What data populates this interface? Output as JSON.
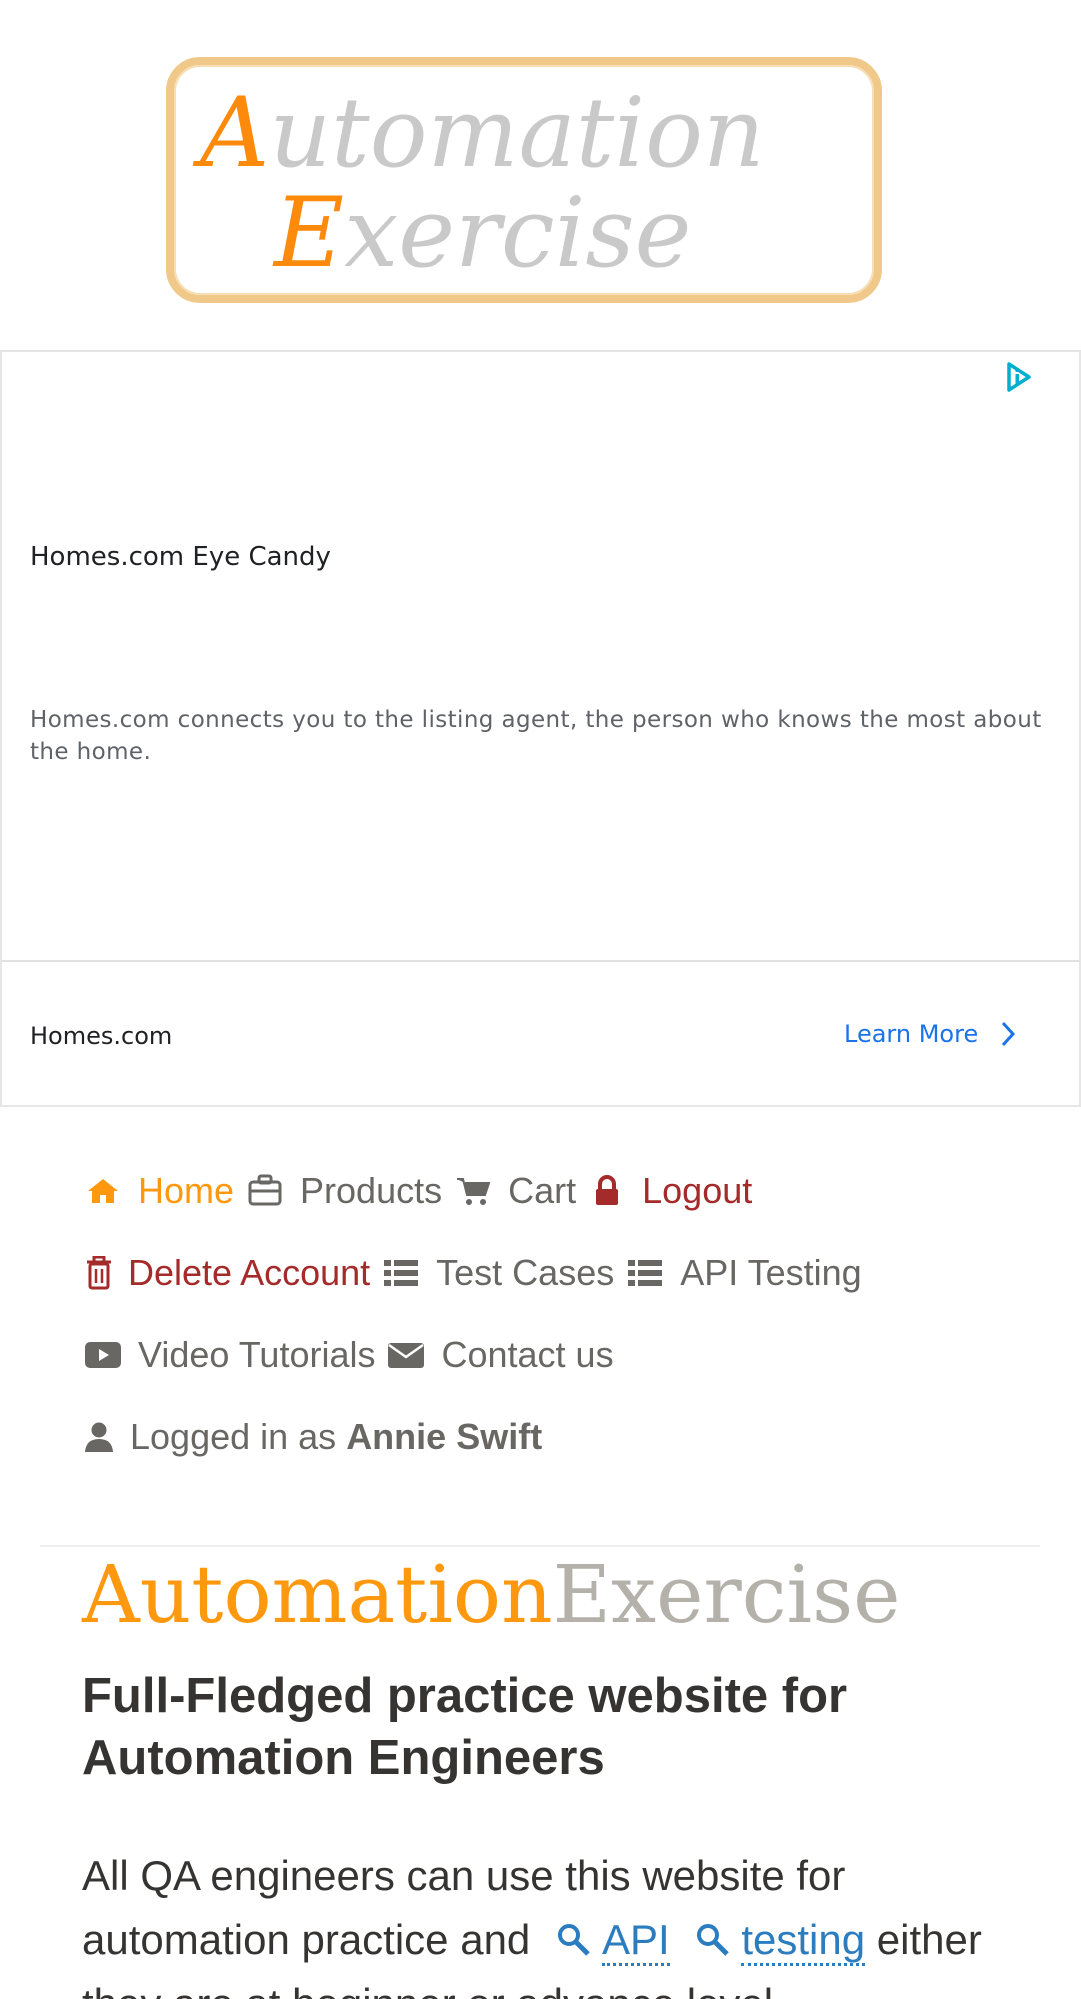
{
  "logo": {
    "line1_cap": "A",
    "line1_rest": "utomation",
    "line2_cap": "E",
    "line2_rest": "xercise"
  },
  "ad": {
    "title": "Homes.com Eye Candy",
    "description": "Homes.com connects you to the listing agent, the person who knows the most about the home.",
    "brand": "Homes.com",
    "cta": "Learn More"
  },
  "nav": {
    "home": "Home",
    "products": "Products",
    "cart": "Cart",
    "logout": "Logout",
    "delete_account": "Delete Account",
    "test_cases": "Test Cases",
    "api_testing": "API Testing",
    "video_tutorials": "Video Tutorials",
    "contact_us": "Contact us",
    "logged_in_as": "Logged in as",
    "username": "Annie Swift"
  },
  "hero": {
    "brand_a": "Automation",
    "brand_b": "Exercise",
    "heading": "Full-Fledged practice website for Automation Engineers",
    "para_start": "All QA engineers can use this website for automation practice and",
    "link_api": "API",
    "link_testing": "testing",
    "para_end": "either they are at beginner or advance level."
  },
  "colors": {
    "accent": "#fe980f",
    "danger": "#a52a2a",
    "link": "#2c7cc0",
    "ad_cta": "#1a73e8"
  }
}
